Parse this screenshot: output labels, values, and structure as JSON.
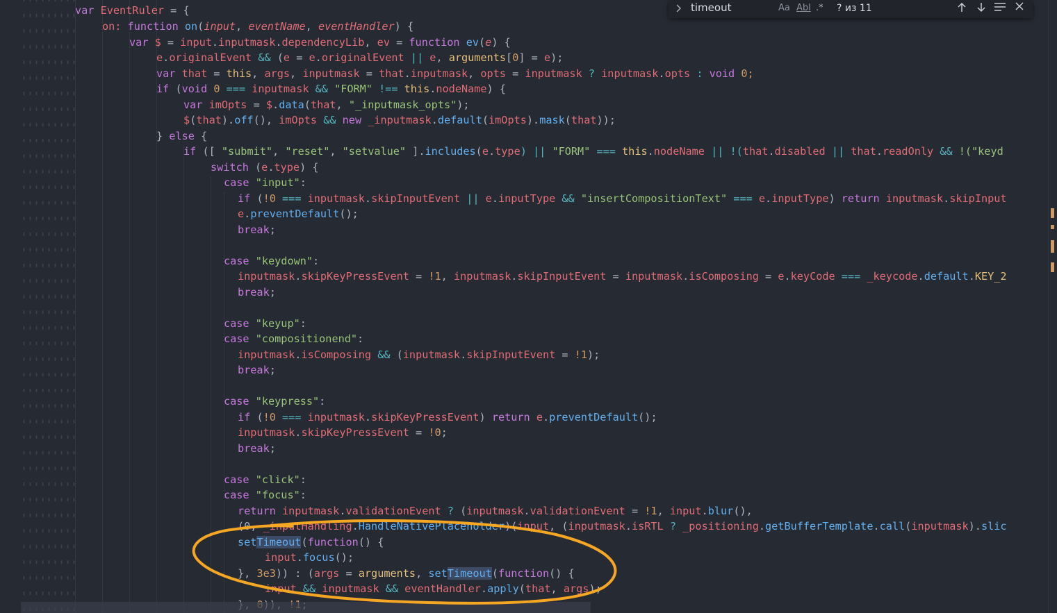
{
  "find": {
    "query": "timeout",
    "match_case": "Aa",
    "whole_word": "Abl",
    "regex": ".*",
    "count": "? из 11",
    "prev_icon": "arrow-up-icon",
    "next_icon": "arrow-down-icon",
    "selection_icon": "lines-icon",
    "close_icon": "close-icon"
  },
  "colors": {
    "background": "#262a33",
    "keyword": "#c678dd",
    "variable": "#e06c75",
    "function": "#61afef",
    "string": "#98c379",
    "number": "#d19a66",
    "annotation": "#f5a623"
  },
  "code": {
    "l01": {
      "a": "var",
      "b": " EventRuler",
      "c": " = {"
    },
    "l02": {
      "a": "on:",
      "b": " function",
      "c": " on",
      "d": "(",
      "e": "input",
      "f": ", ",
      "g": "eventName",
      "h": ", ",
      "i": "eventHandler",
      "j": ") {"
    },
    "l03": {
      "a": "var",
      "b": " $",
      "c": " = ",
      "d": "input",
      "e": ".",
      "f": "inputmask",
      "g": ".",
      "h": "dependencyLib",
      "i": ", ",
      "j": "ev",
      "k": " = ",
      "l": "function",
      "m": " ev",
      "n": "(",
      "o": "e",
      "p": ") {"
    },
    "l04": {
      "a": "e",
      "b": ".",
      "c": "originalEvent",
      "d": " && ",
      "e": "(",
      "f": "e",
      "g": " = ",
      "h": "e",
      "i": ".",
      "j": "originalEvent",
      "k": " || ",
      "l": "e",
      "m": ", ",
      "n": "arguments",
      "o": "[",
      "p": "0",
      "q": "] = ",
      "r": "e",
      "s": ");"
    },
    "l05": {
      "a": "var",
      "b": " that",
      "c": " = ",
      "d": "this",
      "e": ", ",
      "f": "args",
      "g": ", ",
      "h": "inputmask",
      "i": " = ",
      "j": "that",
      "k": ".",
      "l": "inputmask",
      "m": ", ",
      "n": "opts",
      "o": " = ",
      "p": "inputmask",
      "q": " ? ",
      "r": "inputmask",
      "s": ".",
      "t": "opts",
      "u": " : ",
      "v": "void",
      "w": " 0;"
    },
    "l06": {
      "a": "if",
      "b": " (",
      "c": "void",
      "d": " 0 ",
      "e": "===",
      "f": " inputmask",
      "g": " && ",
      "h": "\"FORM\"",
      "i": " !== ",
      "j": "this",
      "k": ".",
      "l": "nodeName",
      "m": ") {"
    },
    "l07": {
      "a": "var",
      "b": " imOpts",
      "c": " = ",
      "d": "$",
      "e": ".",
      "f": "data",
      "g": "(",
      "h": "that",
      "i": ", ",
      "j": "\"_inputmask_opts\"",
      "k": ");"
    },
    "l08": {
      "a": "$",
      "b": "(",
      "c": "that",
      "d": ").",
      "e": "off",
      "f": "(), ",
      "g": "imOpts",
      "h": " && ",
      "i": "new",
      "j": " _inputmask",
      "k": ".",
      "l": "default",
      "m": "(",
      "n": "imOpts",
      "o": ").",
      "p": "mask",
      "q": "(",
      "r": "that",
      "s": "));"
    },
    "l09": {
      "a": "} ",
      "b": "else",
      "c": " {"
    },
    "l10": {
      "a": "if",
      "b": " ([ ",
      "c": "\"submit\"",
      "d": ", ",
      "e": "\"reset\"",
      "f": ", ",
      "g": "\"setvalue\"",
      "h": " ].",
      "i": "includes",
      "j": "(",
      "k": "e",
      "l": ".",
      "m": "type",
      "n": ") || ",
      "o": "\"FORM\"",
      "p": " === ",
      "q": "this",
      "r": ".",
      "s": "nodeName",
      "t": " || ",
      "u": "!(",
      "v": "that",
      "w": ".",
      "x": "disabled",
      "y": " || ",
      "z": "that",
      "aa": ".",
      "ab": "readOnly",
      "ac": " && ",
      "ad": "!(\"keyd"
    },
    "l11": {
      "a": "switch",
      "b": " (",
      "c": "e",
      "d": ".",
      "e": "type",
      "f": ") {"
    },
    "l12": {
      "a": "case",
      "b": " \"input\"",
      "c": ":"
    },
    "l13": {
      "a": "if",
      "b": " (",
      "c": "!0",
      "d": " === ",
      "e": "inputmask",
      "f": ".",
      "g": "skipInputEvent",
      "h": " || ",
      "i": "e",
      "j": ".",
      "k": "inputType",
      "l": " && ",
      "m": "\"insertCompositionText\"",
      "n": " === ",
      "o": "e",
      "p": ".",
      "q": "inputType",
      "r": ") ",
      "s": "return",
      "t": " inputmask",
      "u": ".",
      "v": "skipInput"
    },
    "l14": {
      "a": "e",
      "b": ".",
      "c": "preventDefault",
      "d": "();"
    },
    "l15": {
      "a": "break",
      "b": ";"
    },
    "l16": {
      "a": "case",
      "b": " \"keydown\"",
      "c": ":"
    },
    "l17": {
      "a": "inputmask",
      "b": ".",
      "c": "skipKeyPressEvent",
      "d": " = ",
      "e": "!1",
      "f": ", ",
      "g": "inputmask",
      "h": ".",
      "i": "skipInputEvent",
      "j": " = ",
      "k": "inputmask",
      "l": ".",
      "m": "isComposing",
      "n": " = ",
      "o": "e",
      "p": ".",
      "q": "keyCode",
      "r": " === ",
      "s": "_keycode",
      "t": ".",
      "u": "default",
      "v": ".",
      "w": "KEY_2"
    },
    "l18": {
      "a": "break",
      "b": ";"
    },
    "l19": {
      "a": "case",
      "b": " \"keyup\"",
      "c": ":"
    },
    "l20": {
      "a": "case",
      "b": " \"compositionend\"",
      "c": ":"
    },
    "l21": {
      "a": "inputmask",
      "b": ".",
      "c": "isComposing",
      "d": " && ",
      "e": "(",
      "f": "inputmask",
      "g": ".",
      "h": "skipInputEvent",
      "i": " = ",
      "j": "!1",
      "k": ");"
    },
    "l22": {
      "a": "break",
      "b": ";"
    },
    "l23": {
      "a": "case",
      "b": " \"keypress\"",
      "c": ":"
    },
    "l24": {
      "a": "if",
      "b": " (",
      "c": "!0",
      "d": " === ",
      "e": "inputmask",
      "f": ".",
      "g": "skipKeyPressEvent",
      "h": ") ",
      "i": "return",
      "j": " e",
      "k": ".",
      "l": "preventDefault",
      "m": "();"
    },
    "l25": {
      "a": "inputmask",
      "b": ".",
      "c": "skipKeyPressEvent",
      "d": " = ",
      "e": "!0",
      "f": ";"
    },
    "l26": {
      "a": "break",
      "b": ";"
    },
    "l27": {
      "a": "case",
      "b": " \"click\"",
      "c": ":"
    },
    "l28": {
      "a": "case",
      "b": " \"focus\"",
      "c": ":"
    },
    "l29": {
      "a": "return",
      "b": " inputmask",
      "c": ".",
      "d": "validationEvent",
      "e": " ? ",
      "f": "(",
      "g": "inputmask",
      "h": ".",
      "i": "validationEvent",
      "j": " = ",
      "k": "!1",
      "l": ", ",
      "m": "input",
      "n": ".",
      "o": "blur",
      "p": "(),"
    },
    "l30": {
      "a": "(0, ",
      "b": "_inputHandling",
      "c": ".",
      "d": "HandleNativePlaceholder",
      "e": ")(",
      "f": "input",
      "g": ", (",
      "h": "inputmask",
      "i": ".",
      "j": "isRTL",
      "k": " ? ",
      "l": "_positioning",
      "m": ".",
      "n": "getBufferTemplate",
      "o": ".",
      "p": "call",
      "q": "(",
      "r": "inputmask",
      "s": ").",
      "t": "slic"
    },
    "l31": {
      "a": "set",
      "b": "Timeout",
      "c": "(",
      "d": "function",
      "e": "() {"
    },
    "l32": {
      "a": "input",
      "b": ".",
      "c": "focus",
      "d": "();"
    },
    "l33": {
      "a": "}, ",
      "b": "3e3",
      "c": ")) : (",
      "d": "args",
      "e": " = ",
      "f": "arguments",
      "g": ", ",
      "h": "set",
      "i": "Timeout",
      "j": "(",
      "k": "function",
      "l": "() {"
    },
    "l34": {
      "a": "input",
      "b": " && ",
      "c": "inputmask",
      "d": " && ",
      "e": "eventHandler",
      "f": ".",
      "g": "apply",
      "h": "(",
      "i": "that",
      "j": ", ",
      "k": "args",
      "l": ");"
    },
    "l35": {
      "a": "}, ",
      "b": "0",
      "c": ")), ",
      "d": "!1",
      "e": ";"
    }
  }
}
